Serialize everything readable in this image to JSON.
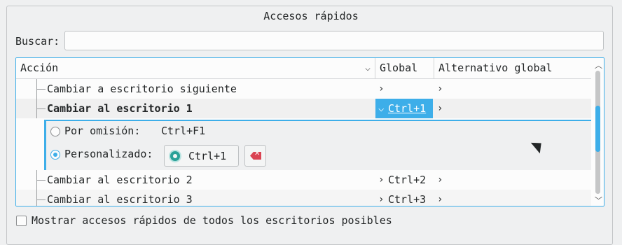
{
  "group": {
    "title": "Accesos rápidos"
  },
  "search": {
    "label": "Buscar:",
    "value": "",
    "placeholder": ""
  },
  "tree": {
    "columns": {
      "action": "Acción",
      "global": "Global",
      "alternative": "Alternativo global"
    },
    "rows": [
      {
        "name": "Cambiar a escritorio siguiente",
        "global": "",
        "alternative": ""
      },
      {
        "name": "Cambiar al escritorio 1",
        "global": "Ctrl+1",
        "alternative": ""
      },
      {
        "name": "Cambiar al escritorio 2",
        "global": "Ctrl+2",
        "alternative": ""
      },
      {
        "name": "Cambiar al escritorio 3",
        "global": "Ctrl+3",
        "alternative": ""
      }
    ],
    "editor": {
      "default_label": "Por omisión:",
      "default_value": "Ctrl+F1",
      "custom_label": "Personalizado:",
      "custom_value": "Ctrl+1",
      "selected": "custom"
    }
  },
  "show_all": {
    "label": "Mostrar accesos rápidos de todos los escritorios posibles",
    "checked": false
  },
  "colors": {
    "accent": "#3daee9",
    "window": "#eff0f1",
    "clear": "#da4453"
  },
  "icons": [
    "chevron-down-icon",
    "chevron-right-icon",
    "gear-icon",
    "clear-icon",
    "mouse-cursor-icon"
  ]
}
